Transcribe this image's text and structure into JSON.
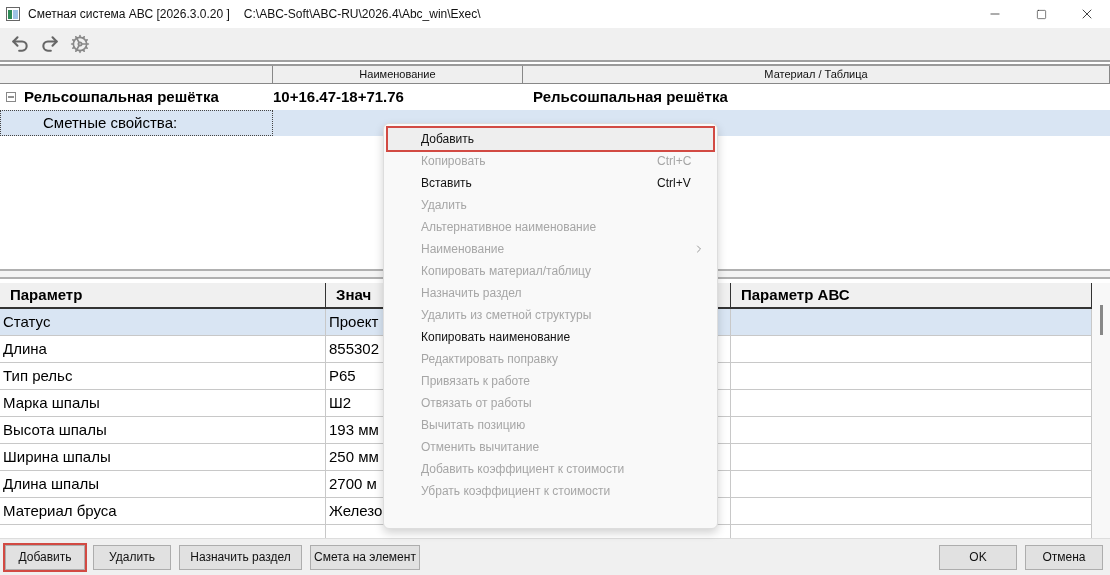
{
  "window": {
    "title": "Сметная система АВС [2026.3.0.20 ]",
    "path": "C:\\ABC-Soft\\ABC-RU\\2026.4\\Abc_win\\Exec\\"
  },
  "tree": {
    "columns": [
      "Наименование",
      "Материал / Таблица"
    ],
    "rows": [
      {
        "name": "Рельсошпальная решётка",
        "code": "10+16.47-18+71.76",
        "material": "Рельсошпальная решётка",
        "expanded": true,
        "selected": false,
        "children": [
          {
            "name": "Сметные свойства:",
            "selected": true
          }
        ]
      }
    ]
  },
  "grid": {
    "columns": [
      "Параметр",
      "Знач",
      "Параметр АВС"
    ],
    "rows": [
      {
        "param": "Статус",
        "value": "Проект",
        "selected": true
      },
      {
        "param": "Длина",
        "value": "855302",
        "selected": false
      },
      {
        "param": "Тип рельс",
        "value": "Р65",
        "selected": false
      },
      {
        "param": "Марка шпалы",
        "value": "Ш2",
        "selected": false
      },
      {
        "param": "Высота шпалы",
        "value": "193  мм",
        "selected": false
      },
      {
        "param": "Ширина шпалы",
        "value": "250  мм",
        "selected": false
      },
      {
        "param": "Длина шпалы",
        "value": "2700  м",
        "selected": false
      },
      {
        "param": "Материал бруса",
        "value": "Железо",
        "selected": false
      }
    ]
  },
  "context_menu": [
    {
      "label": "Добавить",
      "disabled": false,
      "highlighted": true
    },
    {
      "label": "Копировать",
      "shortcut": "Ctrl+C",
      "disabled": true,
      "highlighted": false
    },
    {
      "label": "Вставить",
      "shortcut": "Ctrl+V",
      "disabled": false,
      "highlighted": false
    },
    {
      "label": "Удалить",
      "disabled": true,
      "highlighted": false
    },
    {
      "label": "Альтернативное наименование",
      "disabled": true,
      "highlighted": false
    },
    {
      "label": "Наименование",
      "submenu": true,
      "disabled": true,
      "highlighted": false
    },
    {
      "label": "Копировать материал/таблицу",
      "disabled": true,
      "highlighted": false
    },
    {
      "label": "Назначить раздел",
      "disabled": true,
      "highlighted": false
    },
    {
      "label": "Удалить из сметной структуры",
      "disabled": true,
      "highlighted": false
    },
    {
      "label": "Копировать наименование",
      "disabled": false,
      "highlighted": false
    },
    {
      "label": "Редактировать поправку",
      "disabled": true,
      "highlighted": false
    },
    {
      "label": "Привязать к работе",
      "disabled": true,
      "highlighted": false
    },
    {
      "label": "Отвязать от работы",
      "disabled": true,
      "highlighted": false
    },
    {
      "label": "Вычитать позицию",
      "disabled": true,
      "highlighted": false
    },
    {
      "label": "Отменить вычитание",
      "disabled": true,
      "highlighted": false
    },
    {
      "label": "Добавить коэффициент к стоимости",
      "disabled": true,
      "highlighted": false
    },
    {
      "label": "Убрать коэффициент к стоимости",
      "disabled": true,
      "highlighted": false
    }
  ],
  "buttons_left": [
    {
      "label": "Добавить",
      "highlighted": true
    },
    {
      "label": "Удалить",
      "highlighted": false
    },
    {
      "label": "Назначить раздел",
      "highlighted": false
    },
    {
      "label": "Смета на элемент",
      "highlighted": false
    }
  ],
  "buttons_right": [
    {
      "label": "OK",
      "highlighted": false
    },
    {
      "label": "Отмена",
      "highlighted": false
    }
  ]
}
